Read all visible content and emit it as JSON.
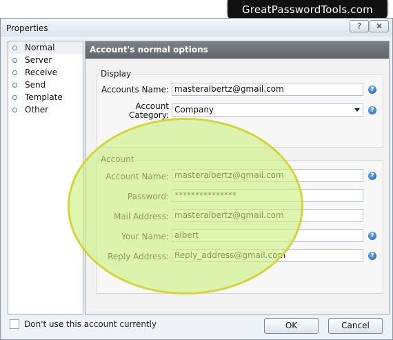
{
  "banner": {
    "text": "GreatPasswordTools.com"
  },
  "window": {
    "title": "Properties",
    "help_icon": "question-icon",
    "close_icon": "close-x-icon"
  },
  "sidebar": {
    "items": [
      {
        "label": "Normal",
        "selected": true
      },
      {
        "label": "Server"
      },
      {
        "label": "Receive"
      },
      {
        "label": "Send"
      },
      {
        "label": "Template"
      },
      {
        "label": "Other"
      }
    ]
  },
  "main": {
    "header": "Account's normal options",
    "display": {
      "legend": "Display",
      "accounts_name_label": "Accounts Name:",
      "accounts_name_value": "masteralbertz@gmail.com",
      "category_label_1": "Account",
      "category_label_2": "Category:",
      "category_value": "Company"
    },
    "account": {
      "legend": "Account",
      "account_name_label": "Account Name:",
      "account_name_value": "masteralbertz@gmail.com",
      "password_label": "Password:",
      "password_value": "***************",
      "mail_address_label": "Mail Address:",
      "mail_address_value": "masteralbertz@gmail.com",
      "your_name_label": "Your Name:",
      "your_name_value": "albert",
      "reply_address_label": "Reply Address:",
      "reply_address_value": "Reply_address@gmail.com"
    }
  },
  "footer": {
    "disable_checkbox_label": "Don't use this account currently",
    "ok_label": "OK",
    "cancel_label": "Cancel"
  },
  "colors": {
    "highlight_fill": "#ccf080",
    "highlight_border": "#d6d33a",
    "header_bg": "#6a6f74",
    "help_blue": "#2a6fc4"
  }
}
